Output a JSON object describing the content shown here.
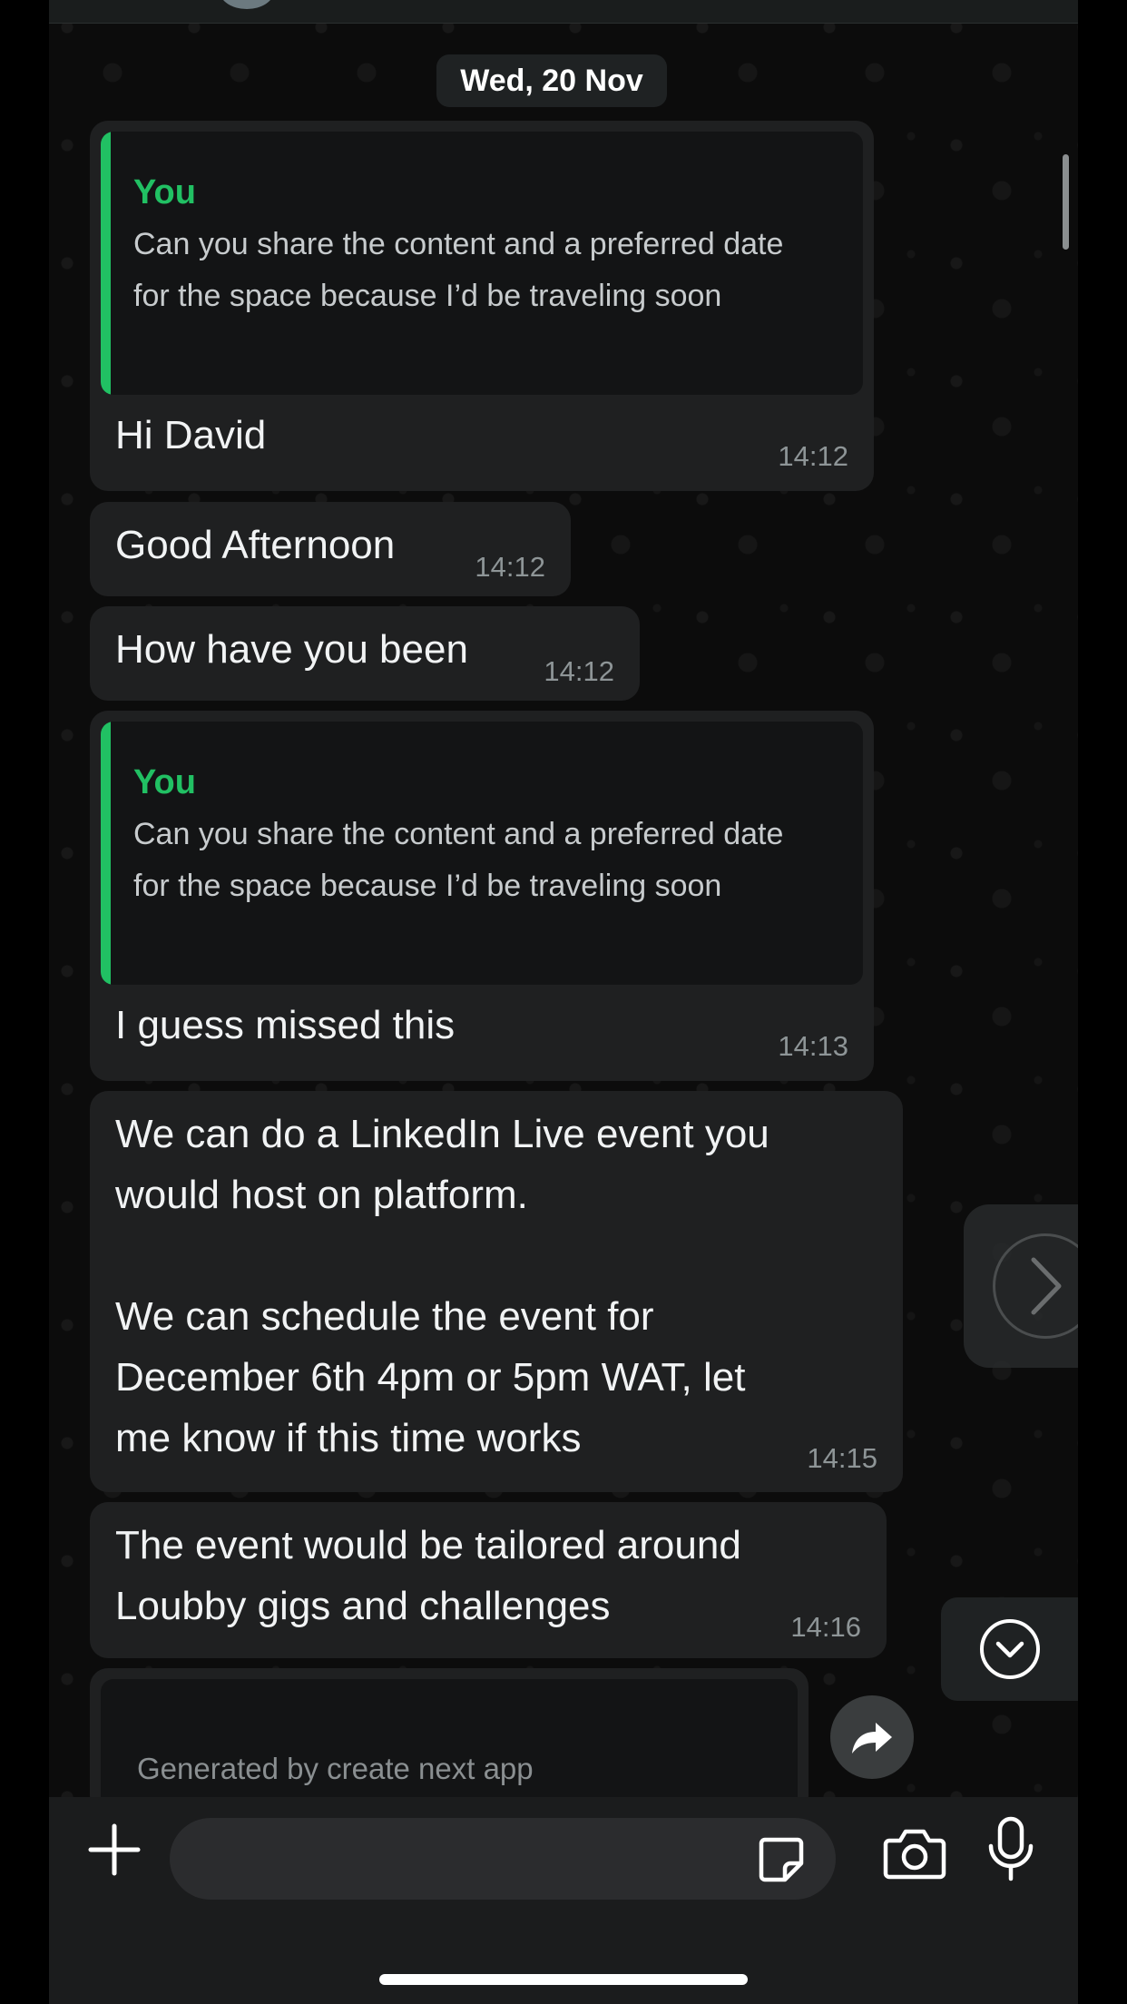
{
  "date_separator": "Wed, 20 Nov",
  "messages": [
    {
      "quote": {
        "author": "You",
        "text": "Can you share the content and a preferred date for the space because I’d be traveling soon"
      },
      "text": "Hi David",
      "time": "14:12"
    },
    {
      "text": "Good Afternoon",
      "time": "14:12"
    },
    {
      "text": "How have you been",
      "time": "14:12"
    },
    {
      "quote": {
        "author": "You",
        "text": "Can you share the content and a preferred date for the space because I’d be traveling soon"
      },
      "text": "I guess missed this",
      "time": "14:13"
    },
    {
      "text": "We can do a LinkedIn Live event you\nwould host on platform.\n\nWe can schedule the event for\nDecember 6th 4pm or 5pm WAT, let\nme know if this time works",
      "time": "14:15"
    },
    {
      "text": "The event would be tailored around\nLoubby gigs and challenges",
      "time": "14:16"
    }
  ],
  "link_preview": {
    "description": "Generated by create next app"
  },
  "composer": {
    "placeholder": ""
  },
  "icons": {
    "plus": "plus-icon",
    "sticker": "sticker-icon",
    "camera": "camera-icon",
    "mic": "microphone-icon",
    "share": "forward-icon",
    "scroll_down": "chevron-down-icon",
    "next": "chevron-right-icon"
  },
  "colors": {
    "accent": "#21c063",
    "bubble": "#1f2021",
    "background": "#0c0c0c"
  }
}
